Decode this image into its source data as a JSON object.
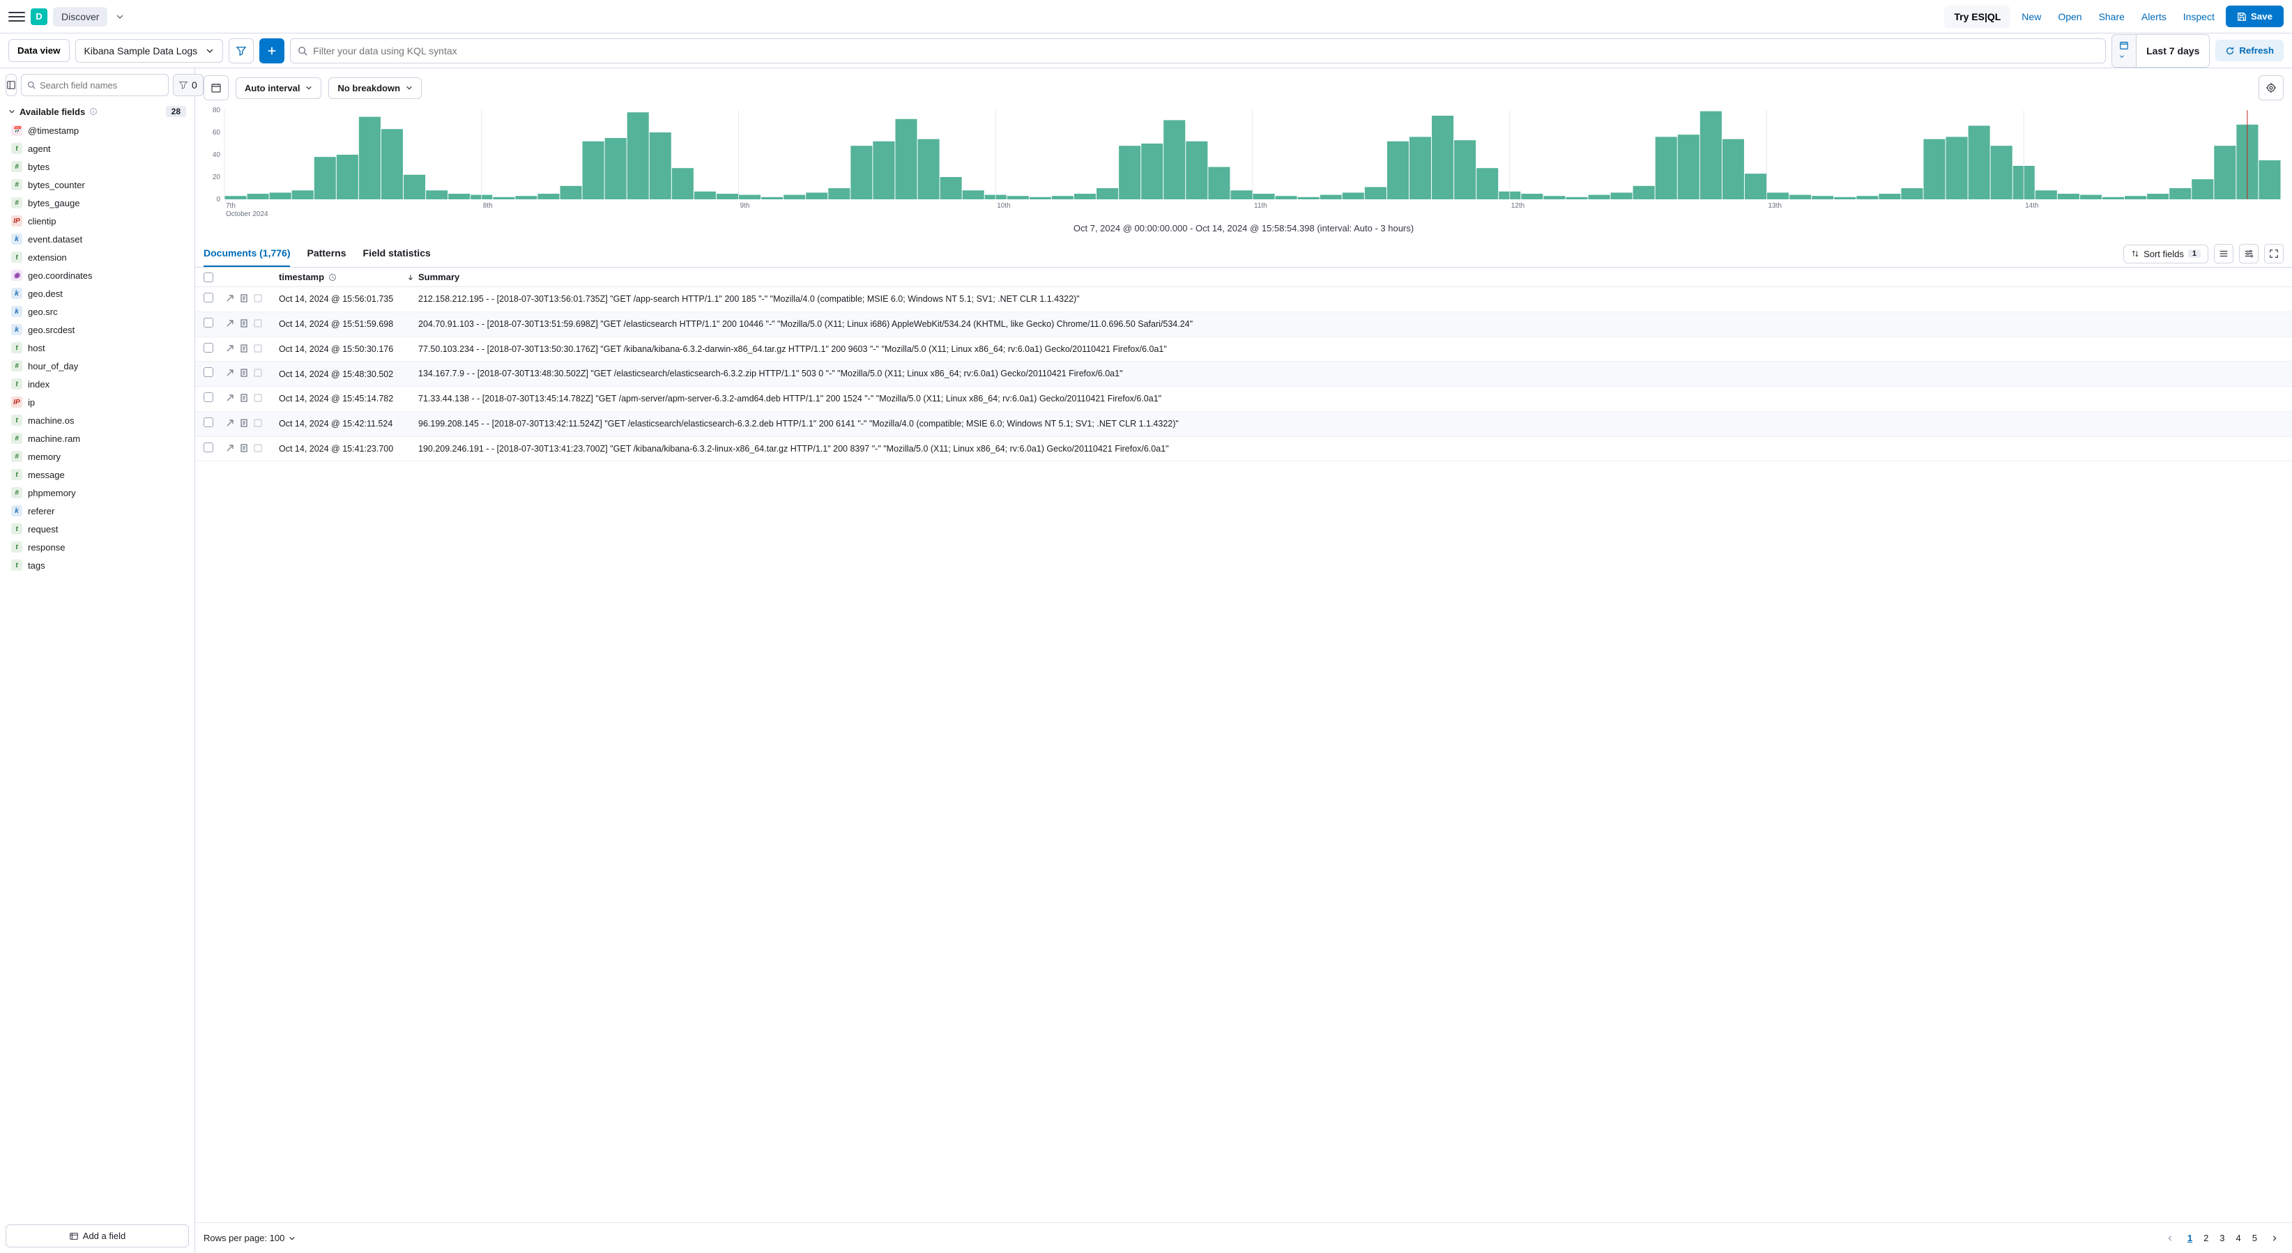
{
  "topbar": {
    "app_initial": "D",
    "discover": "Discover",
    "try_esql": "Try ES|QL",
    "links": [
      "New",
      "Open",
      "Share",
      "Alerts",
      "Inspect"
    ],
    "save": "Save"
  },
  "querybar": {
    "data_view": "Data view",
    "data_view_value": "Kibana Sample Data Logs",
    "search_placeholder": "Filter your data using KQL syntax",
    "date": "Last 7 days",
    "refresh": "Refresh"
  },
  "sidebar": {
    "search_placeholder": "Search field names",
    "filter_count": "0",
    "available_label": "Available fields",
    "available_count": "28",
    "add_field": "Add a field",
    "fields": [
      {
        "type": "date",
        "name": "@timestamp"
      },
      {
        "type": "t",
        "name": "agent"
      },
      {
        "type": "n",
        "name": "bytes"
      },
      {
        "type": "n",
        "name": "bytes_counter"
      },
      {
        "type": "n",
        "name": "bytes_gauge"
      },
      {
        "type": "ip",
        "name": "clientip"
      },
      {
        "type": "k",
        "name": "event.dataset"
      },
      {
        "type": "t",
        "name": "extension"
      },
      {
        "type": "geo",
        "name": "geo.coordinates"
      },
      {
        "type": "k",
        "name": "geo.dest"
      },
      {
        "type": "k",
        "name": "geo.src"
      },
      {
        "type": "k",
        "name": "geo.srcdest"
      },
      {
        "type": "t",
        "name": "host"
      },
      {
        "type": "n",
        "name": "hour_of_day"
      },
      {
        "type": "t",
        "name": "index"
      },
      {
        "type": "ip",
        "name": "ip"
      },
      {
        "type": "t",
        "name": "machine.os"
      },
      {
        "type": "n",
        "name": "machine.ram"
      },
      {
        "type": "n",
        "name": "memory"
      },
      {
        "type": "t",
        "name": "message"
      },
      {
        "type": "n",
        "name": "phpmemory"
      },
      {
        "type": "k",
        "name": "referer"
      },
      {
        "type": "t",
        "name": "request"
      },
      {
        "type": "t",
        "name": "response"
      },
      {
        "type": "t",
        "name": "tags"
      }
    ]
  },
  "chart": {
    "interval": "Auto interval",
    "breakdown": "No breakdown",
    "caption": "Oct 7, 2024 @ 00:00:00.000 - Oct 14, 2024 @ 15:58:54.398 (interval: Auto - 3 hours)"
  },
  "chart_data": {
    "type": "bar",
    "ylim": [
      0,
      80
    ],
    "yticks": [
      0,
      20,
      40,
      60,
      80
    ],
    "xticks": [
      "7th",
      "8th",
      "9th",
      "10th",
      "11th",
      "12th",
      "13th",
      "14th"
    ],
    "xsubtitle": "October 2024",
    "values": [
      3,
      5,
      6,
      8,
      38,
      40,
      74,
      63,
      22,
      8,
      5,
      4,
      2,
      3,
      5,
      12,
      52,
      55,
      78,
      60,
      28,
      7,
      5,
      4,
      2,
      4,
      6,
      10,
      48,
      52,
      72,
      54,
      20,
      8,
      4,
      3,
      2,
      3,
      5,
      10,
      48,
      50,
      71,
      52,
      29,
      8,
      5,
      3,
      2,
      4,
      6,
      11,
      52,
      56,
      75,
      53,
      28,
      7,
      5,
      3,
      2,
      4,
      6,
      12,
      56,
      58,
      79,
      54,
      23,
      6,
      4,
      3,
      2,
      3,
      5,
      10,
      54,
      56,
      66,
      48,
      30,
      8,
      5,
      4,
      2,
      3,
      5,
      10,
      18,
      48,
      67,
      35
    ]
  },
  "tabs": {
    "documents": "Documents (1,776)",
    "patterns": "Patterns",
    "stats": "Field statistics",
    "sort": "Sort fields",
    "sort_count": "1"
  },
  "table": {
    "col_ts": "timestamp",
    "col_sum": "Summary"
  },
  "rows": [
    {
      "ts": "Oct 14, 2024 @ 15:56:01.735",
      "sum": "212.158.212.195 - - [2018-07-30T13:56:01.735Z] \"GET /app-search HTTP/1.1\" 200 185 \"-\" \"Mozilla/4.0 (compatible; MSIE 6.0; Windows NT 5.1; SV1; .NET CLR 1.1.4322)\""
    },
    {
      "ts": "Oct 14, 2024 @ 15:51:59.698",
      "sum": "204.70.91.103 - - [2018-07-30T13:51:59.698Z] \"GET /elasticsearch HTTP/1.1\" 200 10446 \"-\" \"Mozilla/5.0 (X11; Linux i686) AppleWebKit/534.24 (KHTML, like Gecko) Chrome/11.0.696.50 Safari/534.24\""
    },
    {
      "ts": "Oct 14, 2024 @ 15:50:30.176",
      "sum": "77.50.103.234 - - [2018-07-30T13:50:30.176Z] \"GET /kibana/kibana-6.3.2-darwin-x86_64.tar.gz HTTP/1.1\" 200 9603 \"-\" \"Mozilla/5.0 (X11; Linux x86_64; rv:6.0a1) Gecko/20110421 Firefox/6.0a1\""
    },
    {
      "ts": "Oct 14, 2024 @ 15:48:30.502",
      "sum": "134.167.7.9 - - [2018-07-30T13:48:30.502Z] \"GET /elasticsearch/elasticsearch-6.3.2.zip HTTP/1.1\" 503 0 \"-\" \"Mozilla/5.0 (X11; Linux x86_64; rv:6.0a1) Gecko/20110421 Firefox/6.0a1\""
    },
    {
      "ts": "Oct 14, 2024 @ 15:45:14.782",
      "sum": "71.33.44.138 - - [2018-07-30T13:45:14.782Z] \"GET /apm-server/apm-server-6.3.2-amd64.deb HTTP/1.1\" 200 1524 \"-\" \"Mozilla/5.0 (X11; Linux x86_64; rv:6.0a1) Gecko/20110421 Firefox/6.0a1\""
    },
    {
      "ts": "Oct 14, 2024 @ 15:42:11.524",
      "sum": "96.199.208.145 - - [2018-07-30T13:42:11.524Z] \"GET /elasticsearch/elasticsearch-6.3.2.deb HTTP/1.1\" 200 6141 \"-\" \"Mozilla/4.0 (compatible; MSIE 6.0; Windows NT 5.1; SV1; .NET CLR 1.1.4322)\""
    },
    {
      "ts": "Oct 14, 2024 @ 15:41:23.700",
      "sum": "190.209.246.191 - - [2018-07-30T13:41:23.700Z] \"GET /kibana/kibana-6.3.2-linux-x86_64.tar.gz HTTP/1.1\" 200 8397 \"-\" \"Mozilla/5.0 (X11; Linux x86_64; rv:6.0a1) Gecko/20110421 Firefox/6.0a1\""
    }
  ],
  "footer": {
    "rpp": "Rows per page: 100",
    "pages": [
      "1",
      "2",
      "3",
      "4",
      "5"
    ]
  }
}
